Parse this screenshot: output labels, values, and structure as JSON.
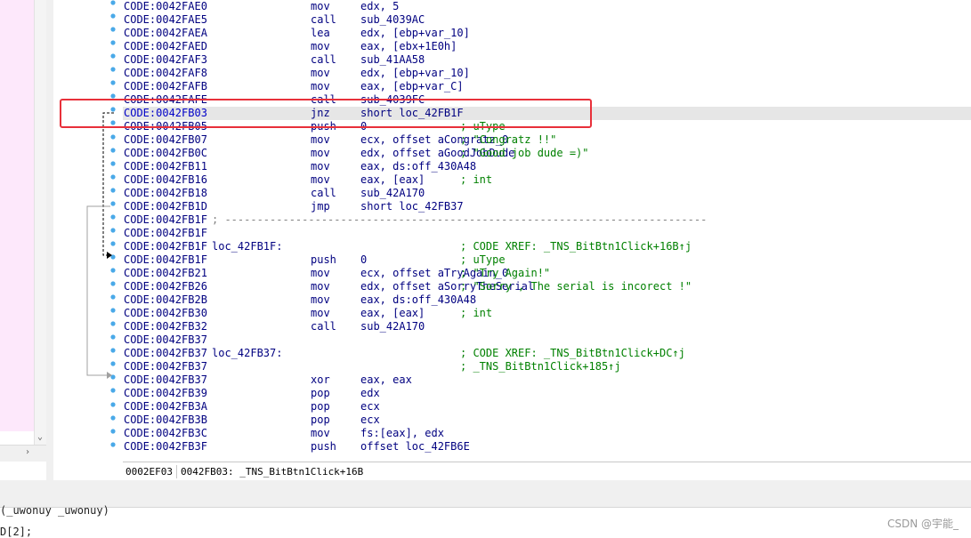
{
  "listing": {
    "rows": [
      {
        "addr": "CODE:0042FAE0",
        "label": "",
        "mnemonic": "mov",
        "operands": "edx, 5",
        "comment": ""
      },
      {
        "addr": "CODE:0042FAE5",
        "label": "",
        "mnemonic": "call",
        "operands": "sub_4039AC",
        "comment": ""
      },
      {
        "addr": "CODE:0042FAEA",
        "label": "",
        "mnemonic": "lea",
        "operands": "edx, [ebp+var_10]",
        "comment": ""
      },
      {
        "addr": "CODE:0042FAED",
        "label": "",
        "mnemonic": "mov",
        "operands": "eax, [ebx+1E0h]",
        "comment": ""
      },
      {
        "addr": "CODE:0042FAF3",
        "label": "",
        "mnemonic": "call",
        "operands": "sub_41AA58",
        "comment": ""
      },
      {
        "addr": "CODE:0042FAF8",
        "label": "",
        "mnemonic": "mov",
        "operands": "edx, [ebp+var_10]",
        "comment": ""
      },
      {
        "addr": "CODE:0042FAFB",
        "label": "",
        "mnemonic": "mov",
        "operands": "eax, [ebp+var_C]",
        "comment": ""
      },
      {
        "addr": "CODE:0042FAFE",
        "label": "",
        "mnemonic": "call",
        "operands": "sub_4039FC",
        "comment": ""
      },
      {
        "addr": "CODE:0042FB03",
        "label": "",
        "mnemonic": "jnz",
        "operands": "short loc_42FB1F",
        "comment": ""
      },
      {
        "addr": "CODE:0042FB05",
        "label": "",
        "mnemonic": "push",
        "operands": "0",
        "comment": "; uType"
      },
      {
        "addr": "CODE:0042FB07",
        "label": "",
        "mnemonic": "mov",
        "operands": "ecx, offset aCongratz_0",
        "comment": "; \"Congratz !!\""
      },
      {
        "addr": "CODE:0042FB0C",
        "label": "",
        "mnemonic": "mov",
        "operands": "edx, offset aGoodJobDude",
        "comment": "; \"Good job dude =)\""
      },
      {
        "addr": "CODE:0042FB11",
        "label": "",
        "mnemonic": "mov",
        "operands": "eax, ds:off_430A48",
        "comment": ""
      },
      {
        "addr": "CODE:0042FB16",
        "label": "",
        "mnemonic": "mov",
        "operands": "eax, [eax]",
        "comment": "; int"
      },
      {
        "addr": "CODE:0042FB18",
        "label": "",
        "mnemonic": "call",
        "operands": "sub_42A170",
        "comment": ""
      },
      {
        "addr": "CODE:0042FB1D",
        "label": "",
        "mnemonic": "jmp",
        "operands": "short loc_42FB37",
        "comment": ""
      },
      {
        "addr": "CODE:0042FB1F",
        "separator": "; ---------------------------------------------------------------------------"
      },
      {
        "addr": "CODE:0042FB1F",
        "label": "",
        "mnemonic": "",
        "operands": "",
        "comment": ""
      },
      {
        "addr": "CODE:0042FB1F",
        "label": "loc_42FB1F:",
        "mnemonic": "",
        "operands": "",
        "comment": "; CODE XREF: _TNS_BitBtn1Click+16B↑j"
      },
      {
        "addr": "CODE:0042FB1F",
        "label": "",
        "mnemonic": "push",
        "operands": "0",
        "comment": "; uType"
      },
      {
        "addr": "CODE:0042FB21",
        "label": "",
        "mnemonic": "mov",
        "operands": "ecx, offset aTryAgain_0",
        "comment": "; \"Try Again!\""
      },
      {
        "addr": "CODE:0042FB26",
        "label": "",
        "mnemonic": "mov",
        "operands": "edx, offset aSorryTheSerial",
        "comment": "; \"Sorry , The serial is incorect !\""
      },
      {
        "addr": "CODE:0042FB2B",
        "label": "",
        "mnemonic": "mov",
        "operands": "eax, ds:off_430A48",
        "comment": ""
      },
      {
        "addr": "CODE:0042FB30",
        "label": "",
        "mnemonic": "mov",
        "operands": "eax, [eax]",
        "comment": "; int"
      },
      {
        "addr": "CODE:0042FB32",
        "label": "",
        "mnemonic": "call",
        "operands": "sub_42A170",
        "comment": ""
      },
      {
        "addr": "CODE:0042FB37",
        "label": "",
        "mnemonic": "",
        "operands": "",
        "comment": ""
      },
      {
        "addr": "CODE:0042FB37",
        "label": "loc_42FB37:",
        "mnemonic": "",
        "operands": "",
        "comment": "; CODE XREF: _TNS_BitBtn1Click+DC↑j"
      },
      {
        "addr": "CODE:0042FB37",
        "label": "",
        "mnemonic": "",
        "operands": "",
        "comment": "; _TNS_BitBtn1Click+185↑j"
      },
      {
        "addr": "CODE:0042FB37",
        "label": "",
        "mnemonic": "xor",
        "operands": "eax, eax",
        "comment": ""
      },
      {
        "addr": "CODE:0042FB39",
        "label": "",
        "mnemonic": "pop",
        "operands": "edx",
        "comment": ""
      },
      {
        "addr": "CODE:0042FB3A",
        "label": "",
        "mnemonic": "pop",
        "operands": "ecx",
        "comment": ""
      },
      {
        "addr": "CODE:0042FB3B",
        "label": "",
        "mnemonic": "pop",
        "operands": "ecx",
        "comment": ""
      },
      {
        "addr": "CODE:0042FB3C",
        "label": "",
        "mnemonic": "mov",
        "operands": "fs:[eax], edx",
        "comment": ""
      },
      {
        "addr": "CODE:0042FB3F",
        "label": "",
        "mnemonic": "push",
        "operands": "offset loc_42FB6E",
        "comment": ""
      }
    ],
    "current_row": 8
  },
  "status_bar": {
    "file_offset": "0002EF03",
    "location": "0042FB03: _TNS_BitBtn1Click+16B"
  },
  "bottom_panel": {
    "line1": "(_uwonuy _uwonuy)",
    "line2": "D[2];"
  },
  "watermark": "CSDN @宇能_",
  "colors": {
    "address": "#000080",
    "comment": "#008000",
    "current_line_bg": "#e6e6e6",
    "annotation_box": "#e8303a",
    "left_panel": "#fde8fb",
    "gutter_dots": "#4aa9e8"
  },
  "icons": {
    "left_scroll_down": "chevron-down-icon",
    "left_scroll_right": "chevron-right-icon"
  }
}
